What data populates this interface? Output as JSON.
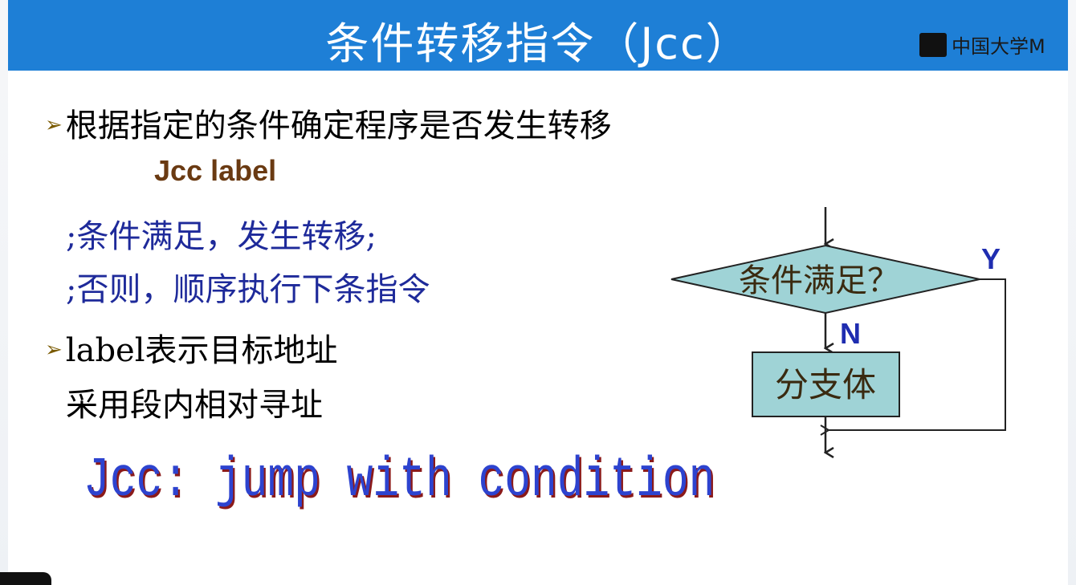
{
  "slide": {
    "title": "条件转移指令（Jcc）",
    "logo_text": "中国大学M",
    "bullet1": "根据指定的条件确定程序是否发生转移",
    "code_line": "Jcc  label",
    "comment1": ";条件满足，发生转移;",
    "comment2": ";否则，顺序执行下条指令",
    "bullet2": "label表示目标地址",
    "sub_line": "采用段内相对寻址",
    "slogan": "Jcc: jump with condition",
    "bullet_marker": "➢"
  },
  "flowchart": {
    "decision": "条件满足？",
    "yes_label": "Y",
    "no_label": "N",
    "body": "分支体",
    "colors": {
      "fill": "#9fd3d6",
      "stroke": "#222222",
      "label": "#1f2db0"
    }
  }
}
